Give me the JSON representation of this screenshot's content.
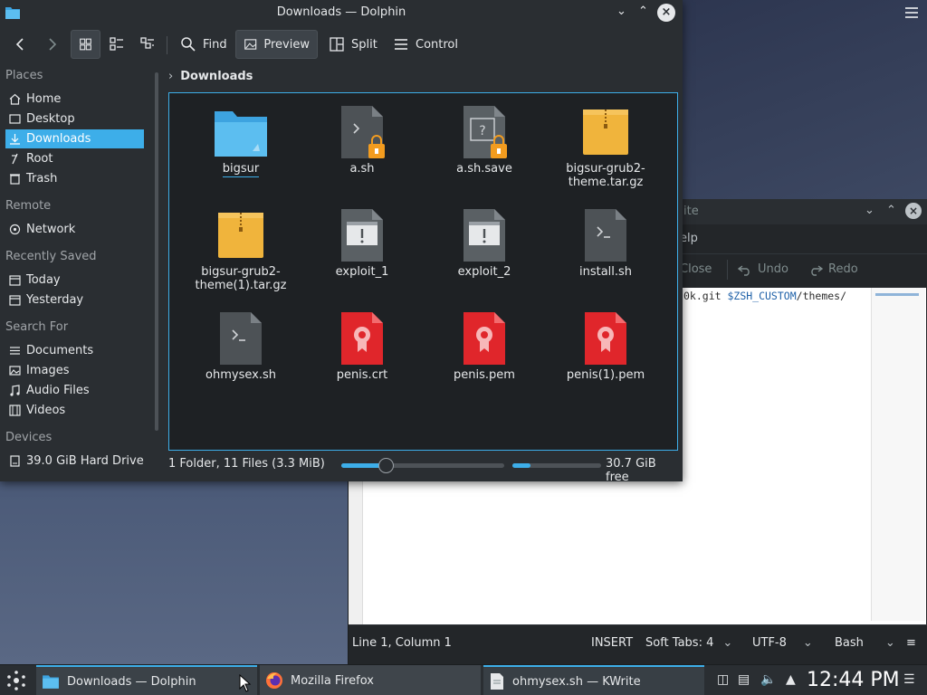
{
  "dolphin": {
    "title": "Downloads — Dolphin",
    "toolbar": {
      "find": "Find",
      "preview": "Preview",
      "split": "Split",
      "control": "Control"
    },
    "breadcrumb": "Downloads",
    "places": {
      "sections": {
        "places": "Places",
        "remote": "Remote",
        "recent": "Recently Saved",
        "search": "Search For",
        "devices": "Devices"
      },
      "items": {
        "home": "Home",
        "desktop": "Desktop",
        "downloads": "Downloads",
        "root": "Root",
        "trash": "Trash",
        "network": "Network",
        "today": "Today",
        "yesterday": "Yesterday",
        "documents": "Documents",
        "images": "Images",
        "audio": "Audio Files",
        "videos": "Videos",
        "drive": "39.0 GiB Hard Drive"
      }
    },
    "files": [
      {
        "name": "bigsur",
        "type": "folder"
      },
      {
        "name": "a.sh",
        "type": "script-locked"
      },
      {
        "name": "a.sh.save",
        "type": "unknown-locked"
      },
      {
        "name": "bigsur-grub2-\ntheme.tar.gz",
        "type": "archive"
      },
      {
        "name": "bigsur-grub2-\ntheme(1).tar.gz",
        "type": "archive"
      },
      {
        "name": "exploit_1",
        "type": "executable"
      },
      {
        "name": "exploit_2",
        "type": "executable"
      },
      {
        "name": "install.sh",
        "type": "script"
      },
      {
        "name": "ohmysex.sh",
        "type": "script"
      },
      {
        "name": "penis.crt",
        "type": "certificate"
      },
      {
        "name": "penis.pem",
        "type": "certificate"
      },
      {
        "name": "penis(1).pem",
        "type": "certificate"
      }
    ],
    "status": "1 Folder, 11 Files (3.3 MiB)",
    "zoom_level": 0.27,
    "disk_used_fraction": 0.2,
    "free_space": "30.7 GiB free"
  },
  "kwrite": {
    "title_fragment": "ite",
    "menu_fragment": "elp",
    "toolbar": {
      "close": "Close",
      "undo": "Undo",
      "redo": "Redo"
    },
    "editor": {
      "line_prefix": "0k.git ",
      "line_var": "$ZSH_CUSTOM",
      "line_suffix": "/themes/"
    },
    "status": {
      "position": "Line 1, Column 1",
      "mode": "INSERT",
      "tabs": "Soft Tabs: 4",
      "encoding": "UTF-8",
      "syntax": "Bash"
    }
  },
  "taskbar": {
    "tasks": {
      "dolphin": "Downloads — Dolphin",
      "firefox": "Mozilla Firefox",
      "kwrite": "ohmysex.sh  — KWrite"
    },
    "clock": "12:44 PM"
  },
  "colors": {
    "accent": "#3daee9",
    "window_bg": "#2a2e32",
    "view_bg": "#1e2124",
    "archive": "#f0b43c",
    "certificate": "#e0262b",
    "folder": "#3da3e0"
  }
}
